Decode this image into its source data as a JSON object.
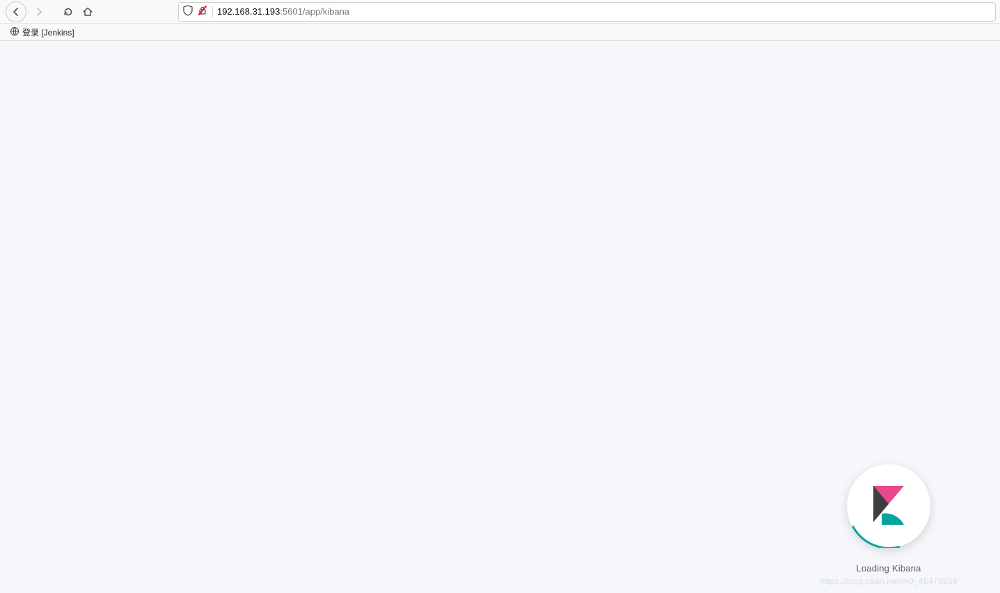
{
  "browser": {
    "url_host": "192.168.31.193",
    "url_rest": ":5601/app/kibana"
  },
  "bookmarks": {
    "item1": "登录 [Jenkins]"
  },
  "splash": {
    "label": "Loading Kibana"
  },
  "watermark": "https://blog.csdn.net/m0_45479839",
  "colors": {
    "kibana_pink": "#e8478b",
    "kibana_teal": "#00a69b",
    "kibana_dark": "#3b3f42"
  }
}
